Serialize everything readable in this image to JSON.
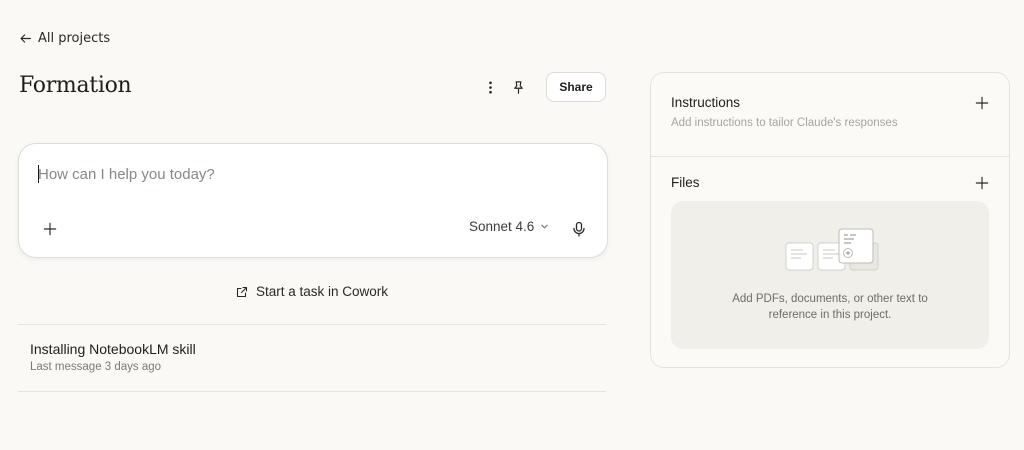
{
  "nav": {
    "back_label": "All projects"
  },
  "project": {
    "title": "Formation",
    "share_label": "Share"
  },
  "composer": {
    "placeholder": "How can I help you today?",
    "value": "",
    "model_label": "Sonnet 4.6"
  },
  "cowork": {
    "label": "Start a task in Cowork"
  },
  "chats": [
    {
      "title": "Installing NotebookLM skill",
      "meta": "Last message 3 days ago"
    }
  ],
  "panel": {
    "instructions": {
      "heading": "Instructions",
      "subtitle": "Add instructions to tailor Claude's responses"
    },
    "files": {
      "heading": "Files",
      "empty_line1": "Add PDFs, documents, or other text to",
      "empty_line2": "reference in this project."
    }
  },
  "icons": {
    "back": "arrow-left-icon",
    "more": "vertical-dots-icon",
    "pin": "pin-icon",
    "add": "plus-icon",
    "model_menu": "chevron-down-icon",
    "mic": "microphone-icon",
    "external": "external-link-icon",
    "docs": "documents-illustration"
  },
  "colors": {
    "background": "#faf9f6",
    "text_primary": "#1f1e1b",
    "text_muted": "#7c7a73",
    "border": "#dedcd5",
    "dropzone": "#f0efea"
  }
}
